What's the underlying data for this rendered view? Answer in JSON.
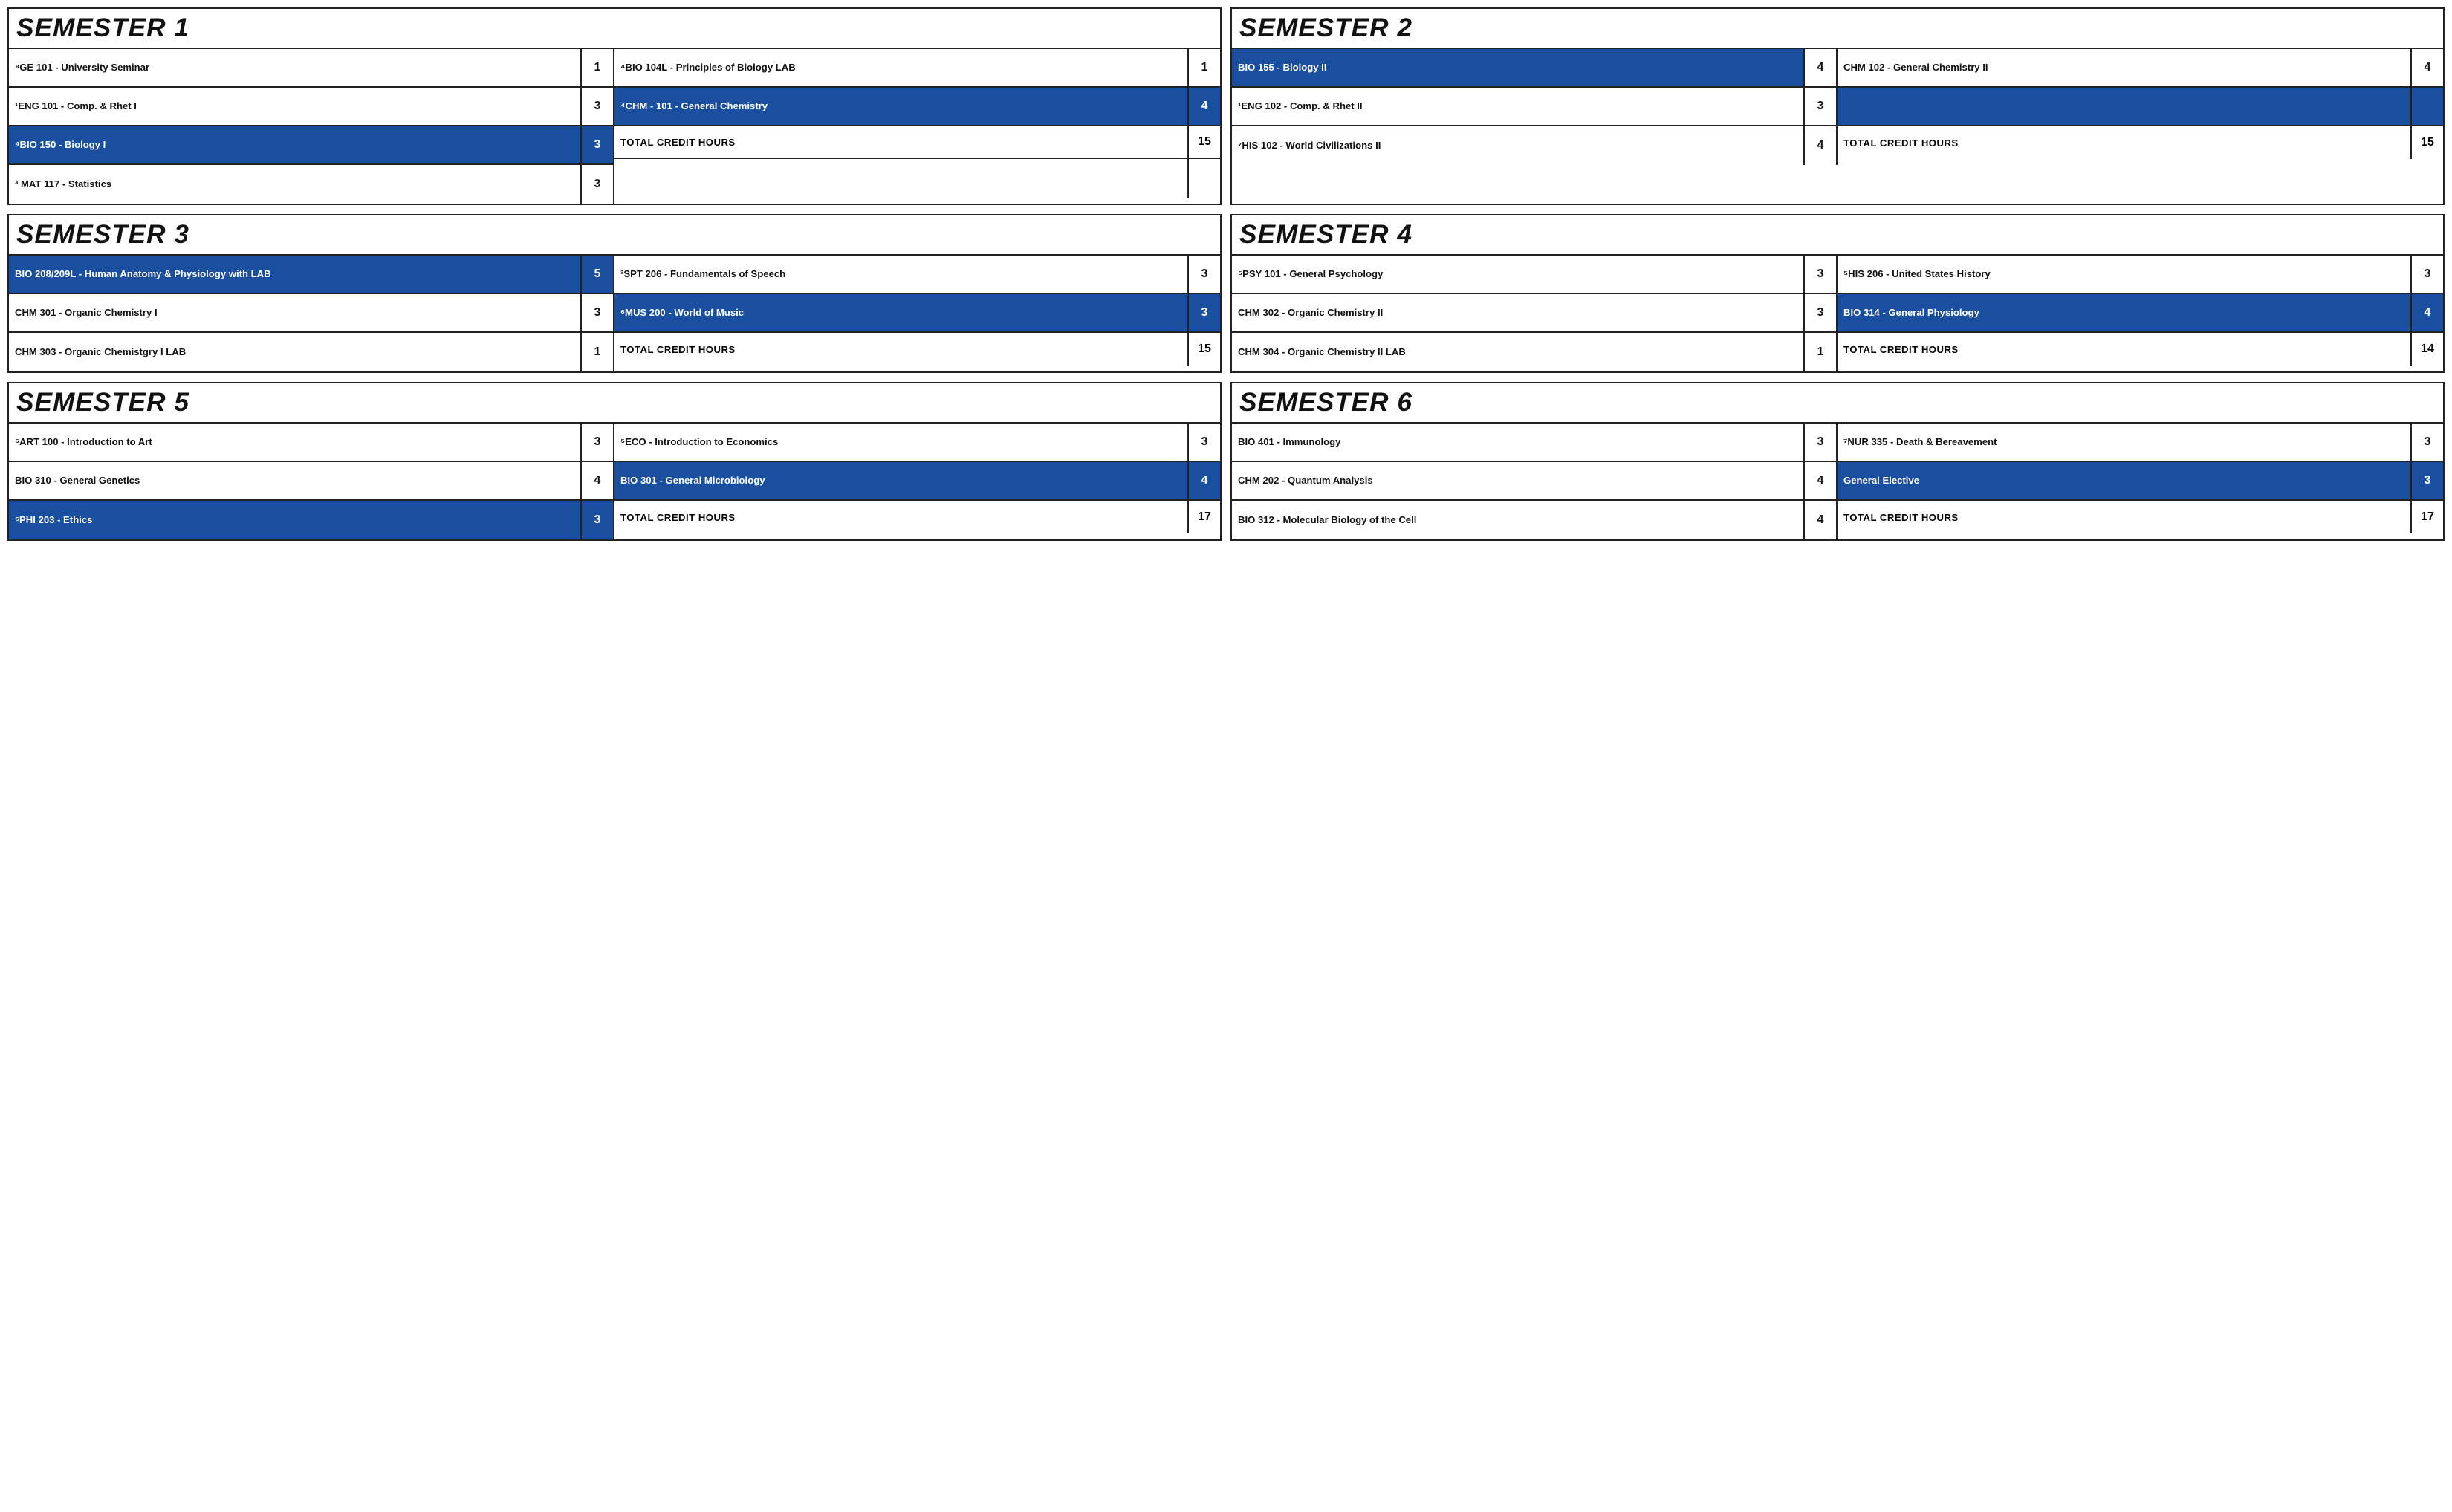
{
  "semesters": [
    {
      "id": "semester-1",
      "title": "SEMESTER 1",
      "left": [
        {
          "name": "⁸GE 101 - University Seminar",
          "credits": "1",
          "blue": false,
          "creditBlue": false
        },
        {
          "name": "¹ENG 101 - Comp. & Rhet I",
          "credits": "3",
          "blue": false,
          "creditBlue": false
        },
        {
          "name": "⁴BIO 150 - Biology I",
          "credits": "3",
          "blue": true,
          "creditBlue": true
        },
        {
          "name": "³ MAT 117 - Statistics",
          "credits": "3",
          "blue": false,
          "creditBlue": false
        }
      ],
      "right": [
        {
          "name": "⁴BIO 104L - Principles of Biology LAB",
          "credits": "1",
          "blue": false,
          "creditBlue": false
        },
        {
          "name": "⁴CHM - 101 - General Chemistry",
          "credits": "4",
          "blue": true,
          "creditBlue": true
        },
        {
          "name": "TOTAL CREDIT HOURS",
          "credits": "15",
          "blue": false,
          "creditBlue": false,
          "isTotal": true
        },
        {
          "name": "",
          "credits": "",
          "blue": false,
          "creditBlue": false,
          "isEmpty": true
        }
      ]
    },
    {
      "id": "semester-2",
      "title": "SEMESTER 2",
      "left": [
        {
          "name": "BIO 155 - Biology II",
          "credits": "4",
          "blue": true,
          "creditBlue": false
        },
        {
          "name": "¹ENG 102 - Comp. & Rhet II",
          "credits": "3",
          "blue": false,
          "creditBlue": false
        },
        {
          "name": "⁷HIS 102 - World Civilizations II",
          "credits": "4",
          "blue": false,
          "creditBlue": false
        }
      ],
      "right": [
        {
          "name": "CHM 102 - General Chemistry II",
          "credits": "4",
          "blue": false,
          "creditBlue": false
        },
        {
          "name": "",
          "credits": "",
          "blue": false,
          "creditBlue": false,
          "isBlueEmpty": true
        },
        {
          "name": "TOTAL CREDIT HOURS",
          "credits": "15",
          "blue": false,
          "creditBlue": false,
          "isTotal": true
        }
      ]
    },
    {
      "id": "semester-3",
      "title": "SEMESTER 3",
      "left": [
        {
          "name": "BIO 208/209L - Human Anatomy & Physiology with LAB",
          "credits": "5",
          "blue": true,
          "creditBlue": true
        },
        {
          "name": "CHM 301 - Organic Chemistry I",
          "credits": "3",
          "blue": false,
          "creditBlue": false
        },
        {
          "name": "CHM 303 - Organic Chemistgry I LAB",
          "credits": "1",
          "blue": false,
          "creditBlue": false
        }
      ],
      "right": [
        {
          "name": "²SPT 206 - Fundamentals of Speech",
          "credits": "3",
          "blue": false,
          "creditBlue": false
        },
        {
          "name": "⁶MUS 200 - World of Music",
          "credits": "3",
          "blue": true,
          "creditBlue": true
        },
        {
          "name": "TOTAL CREDIT HOURS",
          "credits": "15",
          "blue": false,
          "creditBlue": false,
          "isTotal": true
        }
      ]
    },
    {
      "id": "semester-4",
      "title": "SEMESTER 4",
      "left": [
        {
          "name": "⁵PSY 101 - General Psychology",
          "credits": "3",
          "blue": false,
          "creditBlue": false
        },
        {
          "name": "CHM 302 - Organic Chemistry II",
          "credits": "3",
          "blue": false,
          "creditBlue": false
        },
        {
          "name": "CHM 304 - Organic Chemistry II LAB",
          "credits": "1",
          "blue": false,
          "creditBlue": false
        }
      ],
      "right": [
        {
          "name": "⁵HIS 206 - United States History",
          "credits": "3",
          "blue": false,
          "creditBlue": false
        },
        {
          "name": "BIO 314 - General Physiology",
          "credits": "4",
          "blue": true,
          "creditBlue": true
        },
        {
          "name": "TOTAL CREDIT HOURS",
          "credits": "14",
          "blue": false,
          "creditBlue": false,
          "isTotal": true
        }
      ]
    },
    {
      "id": "semester-5",
      "title": "SEMESTER 5",
      "left": [
        {
          "name": "⁶ART 100 - Introduction to Art",
          "credits": "3",
          "blue": false,
          "creditBlue": false
        },
        {
          "name": "BIO 310 - General Genetics",
          "credits": "4",
          "blue": false,
          "creditBlue": false
        },
        {
          "name": "⁶PHI 203 - Ethics",
          "credits": "3",
          "blue": true,
          "creditBlue": true
        }
      ],
      "right": [
        {
          "name": "⁵ECO - Introduction to Economics",
          "credits": "3",
          "blue": false,
          "creditBlue": false
        },
        {
          "name": "BIO 301 - General Microbiology",
          "credits": "4",
          "blue": true,
          "creditBlue": true
        },
        {
          "name": "TOTAL CREDIT HOURS",
          "credits": "17",
          "blue": false,
          "creditBlue": false,
          "isTotal": true
        }
      ]
    },
    {
      "id": "semester-6",
      "title": "SEMESTER 6",
      "left": [
        {
          "name": "BIO 401 - Immunology",
          "credits": "3",
          "blue": false,
          "creditBlue": false
        },
        {
          "name": "CHM 202 - Quantum Analysis",
          "credits": "4",
          "blue": false,
          "creditBlue": false
        },
        {
          "name": "BIO 312 - Molecular Biology of the Cell",
          "credits": "4",
          "blue": false,
          "creditBlue": false
        }
      ],
      "right": [
        {
          "name": "⁷NUR 335 - Death & Bereavement",
          "credits": "3",
          "blue": false,
          "creditBlue": false
        },
        {
          "name": "General Elective",
          "credits": "3",
          "blue": true,
          "creditBlue": true
        },
        {
          "name": "TOTAL CREDIT HOURS",
          "credits": "17",
          "blue": false,
          "creditBlue": false,
          "isTotal": true
        }
      ]
    }
  ]
}
